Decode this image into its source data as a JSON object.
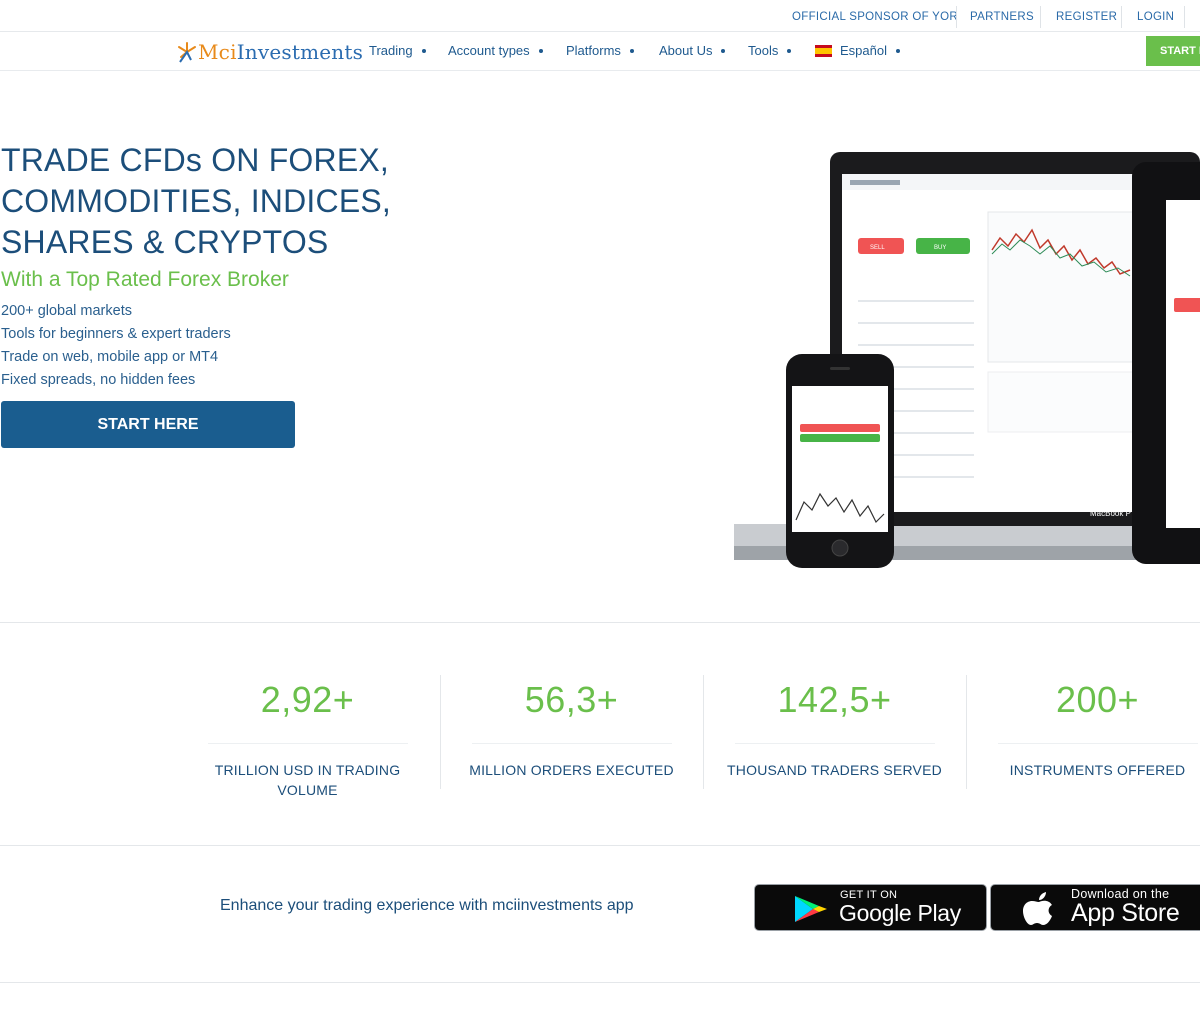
{
  "topbar": {
    "links": [
      "OFFICIAL SPONSOR OF YOR",
      "PARTNERS",
      "REGISTER",
      "LOGIN"
    ]
  },
  "nav": {
    "logo_text_accent": "Mci",
    "logo_text_rest": "Investments",
    "items": [
      {
        "label": "Trading"
      },
      {
        "label": "Account types"
      },
      {
        "label": "Platforms"
      },
      {
        "label": "About Us"
      },
      {
        "label": "Tools"
      },
      {
        "label": "Español"
      }
    ],
    "start_button": "START H"
  },
  "hero": {
    "title_lines": [
      "TRADE CFDs ON FOREX,",
      "COMMODITIES, INDICES,",
      "SHARES & CRYPTOS"
    ],
    "subtitle": "With a Top Rated Forex Broker",
    "bullets": [
      "200+ global markets",
      "Tools for beginners & expert traders",
      "Trade on web, mobile app or MT4",
      "Fixed spreads, no hidden fees"
    ],
    "cta_label": "START HERE"
  },
  "devices": {
    "laptop_brand": "MacBook P",
    "phone_sell": "SELL",
    "phone_buy": "BUY"
  },
  "stats": [
    {
      "value": "2,92+",
      "label": "TRILLION USD IN TRADING VOLUME"
    },
    {
      "value": "56,3+",
      "label": "MILLION ORDERS EXECUTED"
    },
    {
      "value": "142,5+",
      "label": "THOUSAND TRADERS SERVED"
    },
    {
      "value": "200+",
      "label": "INSTRUMENTS OFFERED"
    }
  ],
  "app": {
    "text": "Enhance your trading experience with mciinvestments app",
    "google_small": "GET IT ON",
    "google_big": "Google Play",
    "apple_small": "Download on the",
    "apple_big": "App Store"
  },
  "colors": {
    "primary_blue": "#1a5d8f",
    "accent_green": "#6abf4b",
    "text_blue": "#1c4e7a"
  }
}
